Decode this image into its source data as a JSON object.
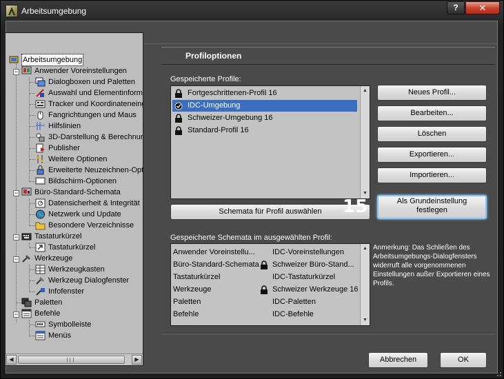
{
  "window": {
    "title": "Arbeitsumgebung",
    "help_label": "?",
    "close_label": "✕"
  },
  "tree": {
    "root": "Arbeitsumgebung",
    "groups": [
      {
        "label": "Anwender Voreinstellungen",
        "children": [
          "Dialogboxen und Paletten",
          "Auswahl und Elementinforma",
          "Tracker und Koordinateneing",
          "Fangrichtungen und Maus",
          "Hilfslinien",
          "3D-Darstellung & Berechnun",
          "Publisher",
          "Weitere Optionen",
          "Erweiterte Neuzeichnen-Opt",
          "Bildschirm-Optionen"
        ]
      },
      {
        "label": "Büro-Standard-Schemata",
        "children": [
          "Datensicherheit & Integrität",
          "Netzwerk und Update",
          "Besondere Verzeichnisse"
        ]
      },
      {
        "label": "Tastaturkürzel",
        "children": [
          "Tastaturkürzel"
        ]
      },
      {
        "label": "Werkzeuge",
        "children": [
          "Werkzeugkasten",
          "Werkzeug Dialogfenster",
          "Infofenster"
        ]
      },
      {
        "label": "Paletten",
        "children": []
      },
      {
        "label": "Befehle",
        "children": [
          "Symbolleiste",
          "Menüs"
        ]
      }
    ]
  },
  "panel": {
    "title": "Profiloptionen",
    "saved_profiles_label": "Gespeicherte Profile:",
    "profiles": [
      {
        "label": "Fortgeschrittenen-Profil 16",
        "locked": true,
        "selected": false
      },
      {
        "label": "IDC-Umgebung",
        "locked": false,
        "selected": true
      },
      {
        "label": "Schweizer-Umgebung 16",
        "locked": true,
        "selected": false
      },
      {
        "label": "Standard-Profil 16",
        "locked": true,
        "selected": false
      }
    ],
    "buttons": {
      "new_profile": "Neues Profil...",
      "edit": "Bearbeiten...",
      "delete": "Löschen",
      "export": "Exportieren...",
      "import": "Importieren...",
      "set_default_line1": "Als Grundeinstellung",
      "set_default_line2": "festlegen",
      "apply_schemas": "Schemata für Profil auswählen",
      "cancel": "Abbrechen",
      "ok": "OK"
    },
    "annotation_number": "15",
    "schemas_label": "Gespeicherte Schemata im ausgewählten Profil:",
    "schemas": [
      {
        "category": "Anwender Voreinstellu...",
        "value": "IDC-Voreinstellungen",
        "locked": false
      },
      {
        "category": "Büro-Standard-Schemata",
        "value": "Schweizer Büro-Stand...",
        "locked": true
      },
      {
        "category": "Tastaturkürzel",
        "value": "IDC-Tastaturkürzel",
        "locked": false
      },
      {
        "category": "Werkzeuge",
        "value": "Schweizer Werkzeuge 16",
        "locked": true
      },
      {
        "category": "Paletten",
        "value": "IDC-Paletten",
        "locked": false
      },
      {
        "category": "Befehle",
        "value": "IDC-Befehle",
        "locked": false
      }
    ],
    "note": "Anmerkung: Das Schließen des Arbeitsumgebungs-Dialogfensters widerruft alle vorgenommenen Einstellungen außer Exportieren eines Profils."
  },
  "colors": {
    "selection": "#3a6fbf",
    "default_button_glow": "#7fc6f6",
    "close_button": "#c7442e"
  }
}
